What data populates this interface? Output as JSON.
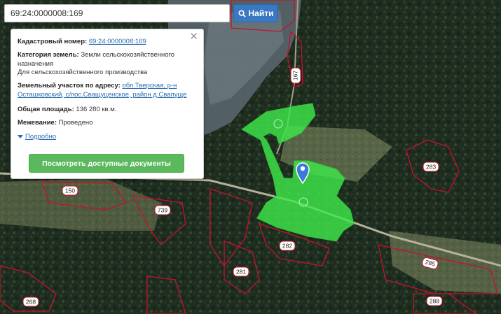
{
  "search": {
    "query": "69:24:0000008:169",
    "button_label": "Найти"
  },
  "info": {
    "cadastral_label": "Кадастровый номер:",
    "cadastral_value": "69:24:0000008:169",
    "category_label": "Категория земель:",
    "category_value": "Земли сельскохозяйственного назначения",
    "usage_value": "Для сельскохозяйственного производства",
    "address_label": "Земельный участок по адресу:",
    "address_value": "обл.Тверская, р-н Осташковский, с/пос.Сващуценское, район д.Свапуще",
    "area_label": "Общая площадь:",
    "area_value": "136 280 кв.м.",
    "survey_label": "Межевание:",
    "survey_value": "Проведено",
    "more_label": "Подробно",
    "docs_button": "Посмотреть доступные документы"
  },
  "map": {
    "parcel_labels": [
      "167",
      "283",
      "150",
      "739",
      "282",
      "281",
      "285",
      "268",
      "288"
    ],
    "highlight_color": "#3ee84a",
    "boundary_color": "#c8102e",
    "marker_color": "#3a7bd5"
  }
}
